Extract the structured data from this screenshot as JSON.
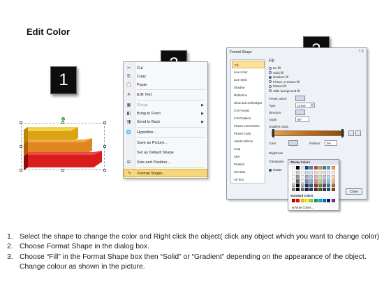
{
  "title": "Edit Color",
  "badges": [
    "1",
    "2",
    "3"
  ],
  "arrows": {
    "colors": {
      "yellow_light": "#f3d24a",
      "yellow": "#d9a514",
      "orange": "#e0861c",
      "orange_dark": "#b85a08",
      "red": "#d91c1c",
      "red_dark": "#8f0c0c"
    }
  },
  "context_menu": {
    "items": [
      {
        "label": "Cut",
        "icon": "scissors-icon",
        "glyph": "✂",
        "disabled": false,
        "submenu": false
      },
      {
        "label": "Copy",
        "icon": "copy-icon",
        "glyph": "⎘",
        "disabled": false,
        "submenu": false
      },
      {
        "label": "Paste",
        "icon": "paste-icon",
        "glyph": "📋",
        "disabled": false,
        "submenu": false
      },
      {
        "label": "Edit Text",
        "icon": "edit-text-icon",
        "glyph": "A",
        "disabled": false,
        "submenu": false
      },
      {
        "label": "Group",
        "icon": "group-icon",
        "glyph": "▦",
        "disabled": true,
        "submenu": true
      },
      {
        "label": "Bring to Front",
        "icon": "bring-front-icon",
        "glyph": "◧",
        "disabled": false,
        "submenu": true
      },
      {
        "label": "Send to Back",
        "icon": "send-back-icon",
        "glyph": "◨",
        "disabled": false,
        "submenu": true
      },
      {
        "label": "Hyperlink...",
        "icon": "hyperlink-icon",
        "glyph": "🌐",
        "disabled": false,
        "submenu": false
      },
      {
        "label": "Save as Picture...",
        "icon": "",
        "glyph": "",
        "disabled": false,
        "submenu": false
      },
      {
        "label": "Set as Default Shape",
        "icon": "",
        "glyph": "",
        "disabled": false,
        "submenu": false
      },
      {
        "label": "Size and Position...",
        "icon": "size-position-icon",
        "glyph": "⊞",
        "disabled": false,
        "submenu": false
      },
      {
        "label": "Format Shape...",
        "icon": "format-shape-icon",
        "glyph": "✎",
        "disabled": false,
        "submenu": false
      }
    ]
  },
  "dialog": {
    "title": "Format Shape",
    "controls": "? X",
    "nav": [
      "Fill",
      "Line Color",
      "Line Style",
      "Shadow",
      "Reflection",
      "Glow and Soft Edges",
      "3-D Format",
      "3-D Rotation",
      "Picture Corrections",
      "Picture Color",
      "Artistic Effects",
      "Crop",
      "Size",
      "Position",
      "Text Box",
      "Alt Text"
    ],
    "fill_heading": "Fill",
    "fill_options": [
      "No fill",
      "Solid fill",
      "Gradient fill",
      "Picture or texture fill",
      "Pattern fill",
      "Slide background fill"
    ],
    "selected_fill": 2,
    "preset_label": "Preset colors:",
    "type_label": "Type:",
    "type_value": "Linear",
    "direction_label": "Direction:",
    "angle_label": "Angle:",
    "angle_value": "90°",
    "gradient_stops_label": "Gradient stops",
    "color_label": "Color",
    "position_label": "Position:",
    "position_value": "0%",
    "brightness_label": "Brightness",
    "transparency_label": "Transparen",
    "rotate_label": "Rotate",
    "close_label": "Close"
  },
  "picker": {
    "theme_label": "Theme Colors",
    "standard_label": "Standard Colors",
    "more_label": "More Colors...",
    "theme_columns": [
      "#ffffff",
      "#000000",
      "#eeece1",
      "#1f497d",
      "#4f81bd",
      "#c0504d",
      "#9bbb59",
      "#8064a2",
      "#4bacc6",
      "#f79646"
    ],
    "standard": [
      "#c00000",
      "#ff0000",
      "#ffc000",
      "#ffff00",
      "#92d050",
      "#00b050",
      "#00b0f0",
      "#0070c0",
      "#002060",
      "#7030a0"
    ]
  },
  "instructions": [
    {
      "num": "1.",
      "text": "Select the shape to change the color and Right click the object( click any object which you want to change color)"
    },
    {
      "num": "2.",
      "text": "Choose Format Shape in the dialog box."
    },
    {
      "num": "3.",
      "text": "Choose “Fill” in the Format Shape box then “Solid” or “Gradient” depending on the appearance of the object. Change colour as shown in the picture."
    }
  ]
}
